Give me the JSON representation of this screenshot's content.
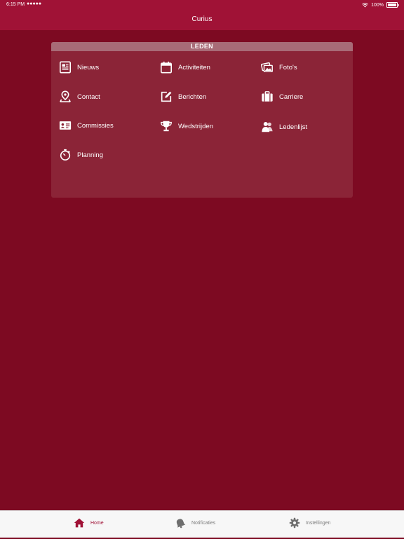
{
  "status_bar": {
    "time": "6:15 PM",
    "signal": "●●●●●",
    "battery": "100%"
  },
  "app": {
    "title": "Curius"
  },
  "panel": {
    "header": "LEDEN",
    "items": [
      {
        "label": "Nieuws",
        "icon": "newspaper-icon"
      },
      {
        "label": "Activiteiten",
        "icon": "calendar-icon"
      },
      {
        "label": "Foto's",
        "icon": "photos-icon"
      },
      {
        "label": "Contact",
        "icon": "location-pin-icon"
      },
      {
        "label": "Berichten",
        "icon": "compose-icon"
      },
      {
        "label": "Carriere",
        "icon": "briefcase-icon"
      },
      {
        "label": "Commissies",
        "icon": "id-card-icon"
      },
      {
        "label": "Wedstrijden",
        "icon": "trophy-icon"
      },
      {
        "label": "Ledenlijst",
        "icon": "members-icon"
      },
      {
        "label": "Planning",
        "icon": "stopwatch-icon"
      }
    ]
  },
  "tabbar": {
    "tabs": [
      {
        "label": "Home",
        "icon": "home-icon",
        "active": true
      },
      {
        "label": "Notificaties",
        "icon": "bell-icon",
        "active": false
      },
      {
        "label": "Instellingen",
        "icon": "gear-icon",
        "active": false
      }
    ]
  },
  "colors": {
    "nav": "#a01236",
    "background": "#7d0a22",
    "panel": "#8b2437",
    "panel_header": "#a86b77",
    "tabbar": "#f7f7f7"
  }
}
